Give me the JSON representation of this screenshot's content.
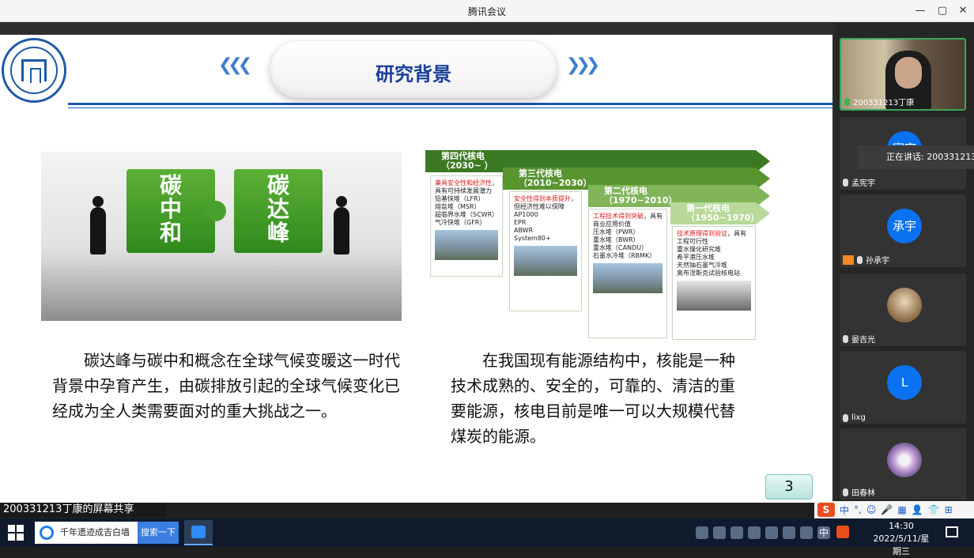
{
  "window": {
    "title": "腾讯会议",
    "controls": [
      "—",
      "▢",
      "✕"
    ]
  },
  "slide": {
    "title": "研究背景",
    "left_image": {
      "pieces": [
        "碳中和",
        "碳达峰"
      ]
    },
    "diagram": {
      "generations": [
        {
          "name": "第四代核电",
          "years": "（2030~  ）",
          "highlight": "兼具安全性和经济性",
          "desc": "，具有可持续发展潜力",
          "items": [
            "铅基快堆（LFR）",
            "熔盐堆（MSR）",
            "超临界水堆（SCWR）",
            "气冷快堆（GFR）"
          ]
        },
        {
          "name": "第三代核电",
          "years": "（2010~2030）",
          "highlight": "安全性得到本质提升",
          "desc": "，但经济性难以保障",
          "items": [
            "AP1000",
            "EPR",
            "ABWR",
            "System80+"
          ]
        },
        {
          "name": "第二代核电",
          "years": "（1970~2010）",
          "highlight": "工程技术得到突破",
          "desc": "，具有商业应用价值",
          "items": [
            "压水堆（PWR）",
            "重水堆（BWR）",
            "重水堆（CANDU）",
            "石墨水冷堆（RBMK）"
          ]
        },
        {
          "name": "第一代核电",
          "years": "（1950~1970）",
          "highlight": "技术原理得到验证",
          "desc": "，具有工程可行性",
          "items": [
            "重水慢化研究堆",
            "希平港压水堆",
            "天然铀石墨气冷堆",
            "奥布涅斯克试验核电站"
          ]
        }
      ]
    },
    "left_paragraph": "碳达峰与碳中和概念在全球气候变暖这一时代背景中孕育产生，由碳排放引起的全球气候变化已经成为全人类需要面对的重大挑战之一。",
    "right_paragraph": "在我国现有能源结构中，核能是一种技术成熟的、安全的，可靠的、清洁的重要能源，核电目前是唯一可以大规模代替煤炭的能源。",
    "page_number": "3"
  },
  "participants": [
    {
      "name": "200331213丁康",
      "avatar": "",
      "type": "video"
    },
    {
      "name": "孟宪宇",
      "avatar": "宪宇",
      "type": "avatar"
    },
    {
      "name": "孙承宇",
      "avatar": "承宇",
      "type": "avatar"
    },
    {
      "name": "晏吉光",
      "avatar": "",
      "type": "photo"
    },
    {
      "name": "lixg",
      "avatar": "L",
      "type": "avatar"
    },
    {
      "name": "田春林",
      "avatar": "",
      "type": "photo"
    }
  ],
  "speaking_label": "正在讲话: 200331213丁",
  "share_label": "200331213丁康的屏幕共享",
  "ime": {
    "items": [
      "中",
      "°,",
      "☺",
      "🎤",
      "▦",
      "👤",
      "👕",
      "⊞"
    ]
  },
  "taskbar": {
    "search_text": "千年遗迹成吉白墙",
    "search_button": "搜索一下",
    "tray_lang": "中",
    "time": "14:30",
    "date": "2022/5/11/星期三"
  },
  "colors": {
    "accent": "#1d58a7",
    "title_text": "#1a3f99",
    "green": "#3a8a1f"
  }
}
